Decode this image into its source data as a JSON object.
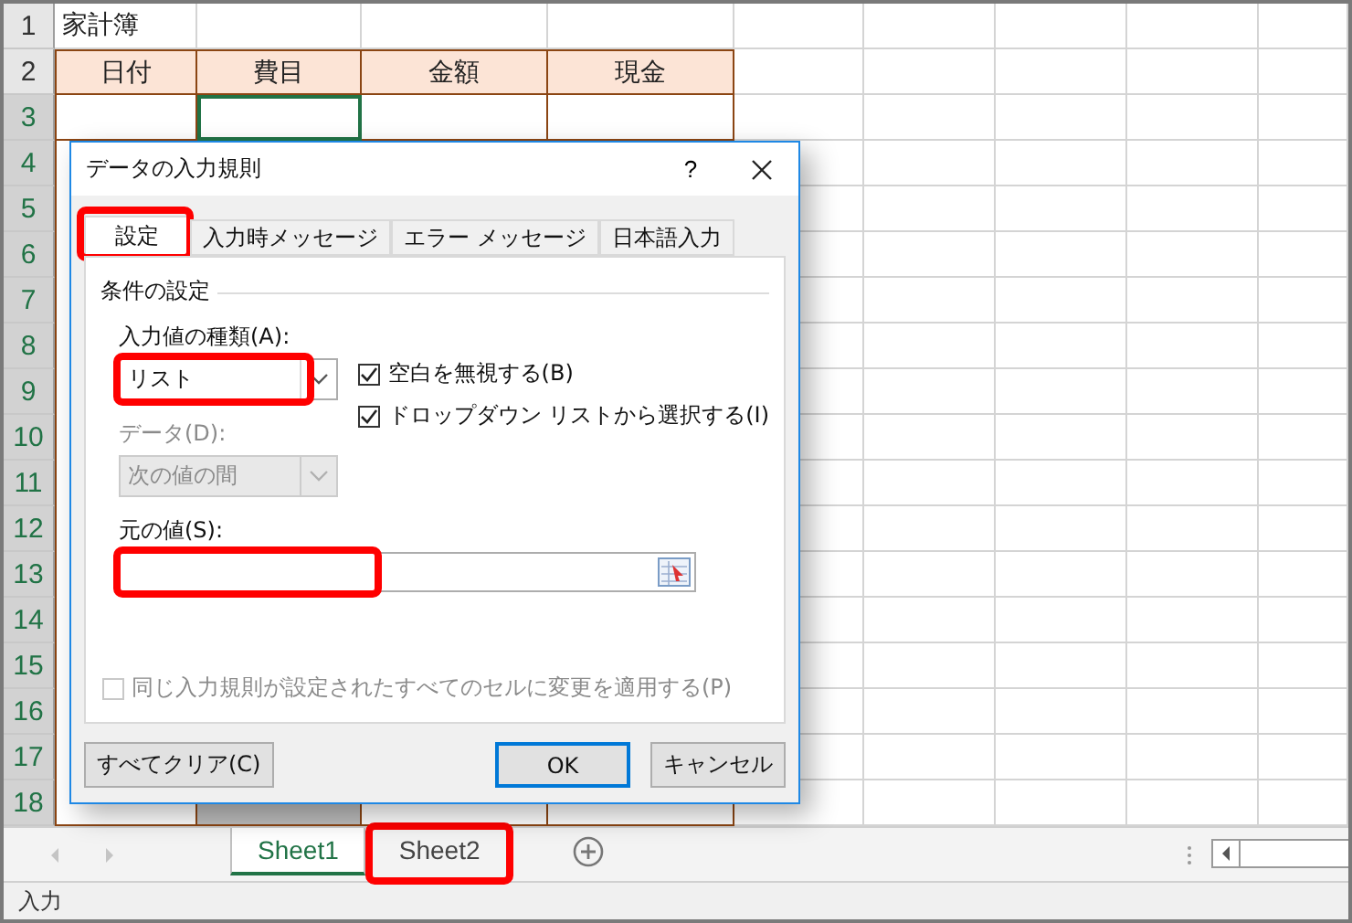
{
  "sheet": {
    "rows": [
      {
        "number": "1",
        "selected": false,
        "kind": "title",
        "cells": [
          "家計簿"
        ]
      },
      {
        "number": "2",
        "selected": false,
        "kind": "header",
        "cells": [
          "日付",
          "費目",
          "金額",
          "現金"
        ]
      },
      {
        "number": "3",
        "selected": true,
        "kind": "data"
      },
      {
        "number": "4",
        "selected": true,
        "kind": "data"
      },
      {
        "number": "5",
        "selected": true,
        "kind": "data"
      },
      {
        "number": "6",
        "selected": true,
        "kind": "data"
      },
      {
        "number": "7",
        "selected": true,
        "kind": "data"
      },
      {
        "number": "8",
        "selected": true,
        "kind": "data"
      },
      {
        "number": "9",
        "selected": true,
        "kind": "data"
      },
      {
        "number": "10",
        "selected": true,
        "kind": "data"
      },
      {
        "number": "11",
        "selected": true,
        "kind": "data"
      },
      {
        "number": "12",
        "selected": true,
        "kind": "data"
      },
      {
        "number": "13",
        "selected": true,
        "kind": "data"
      },
      {
        "number": "14",
        "selected": true,
        "kind": "data"
      },
      {
        "number": "15",
        "selected": true,
        "kind": "data"
      },
      {
        "number": "16",
        "selected": true,
        "kind": "data"
      },
      {
        "number": "17",
        "selected": true,
        "kind": "data"
      },
      {
        "number": "18",
        "selected": true,
        "kind": "data"
      }
    ]
  },
  "dialog": {
    "title": "データの入力規則",
    "help": "?",
    "tabs": [
      {
        "label": "設定",
        "selected": true,
        "highlighted": true
      },
      {
        "label": "入力時メッセージ",
        "selected": false,
        "highlighted": false
      },
      {
        "label": "エラー メッセージ",
        "selected": false,
        "highlighted": false
      },
      {
        "label": "日本語入力",
        "selected": false,
        "highlighted": false
      }
    ],
    "group_label": "条件の設定",
    "allow": {
      "label": "入力値の種類(A):",
      "value": "リスト",
      "highlighted": true
    },
    "options": [
      {
        "label": "空白を無視する(B)",
        "checked": true
      },
      {
        "label": "ドロップダウン リストから選択する(I)",
        "checked": true
      }
    ],
    "data": {
      "label": "データ(D):",
      "value": "次の値の間",
      "disabled": true
    },
    "source": {
      "label": "元の値(S):",
      "highlighted": true
    },
    "apply_all": {
      "label": "同じ入力規則が設定されたすべてのセルに変更を適用する(P)",
      "checked": false,
      "disabled": true
    },
    "buttons": [
      {
        "label": "すべてクリア(C)",
        "kind": "clear"
      },
      {
        "label": "OK",
        "kind": "default"
      },
      {
        "label": "キャンセル",
        "kind": "cancel"
      }
    ]
  },
  "sheet_tabs": [
    {
      "label": "Sheet1",
      "selected": true,
      "highlighted": false
    },
    {
      "label": "Sheet2",
      "selected": false,
      "highlighted": true
    }
  ],
  "status_bar": {
    "text": "入力"
  }
}
